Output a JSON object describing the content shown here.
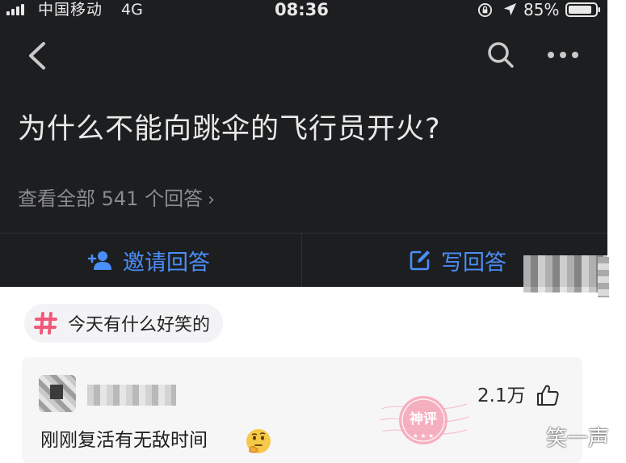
{
  "status_bar": {
    "carrier": "中国移动",
    "network": "4G",
    "time": "08:36",
    "battery": "85%",
    "icons": [
      "signal-icon",
      "rotation-lock-icon",
      "location-icon",
      "battery-icon"
    ]
  },
  "nav": {
    "icons": [
      "back-icon",
      "search-icon",
      "more-icon"
    ]
  },
  "question": {
    "title": "为什么不能向跳伞的飞行员开火?",
    "view_all": "查看全部 541 个回答",
    "view_all_chevron": "›"
  },
  "actions": {
    "invite_label": "邀请回答",
    "write_label": "写回答"
  },
  "topic": {
    "label": "今天有什么好笑的"
  },
  "comment": {
    "likes": "2.1万",
    "text": "刚刚复活有无敌时间",
    "emoji": "thinking-face-icon"
  },
  "stamp_text": "神评",
  "watermark": "笑一声",
  "colors": {
    "header_background": "#1d1e20",
    "accent_blue": "#4a8ef7",
    "topic_hash": "#f0597a",
    "stamp_pink": "#f4a3b6"
  }
}
